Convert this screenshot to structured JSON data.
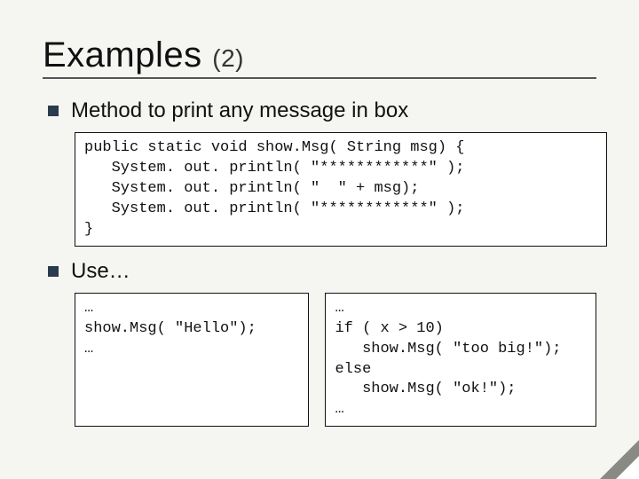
{
  "title": {
    "main": "Examples",
    "sub": "(2)"
  },
  "bullets": {
    "b1": "Method to print any message in box",
    "b2": "Use…"
  },
  "code": {
    "main": "public static void show.Msg( String msg) {\n   System. out. println( \"************\" );\n   System. out. println( \"  \" + msg);\n   System. out. println( \"************\" );\n}",
    "left": "…\nshow.Msg( \"Hello\");\n…",
    "right": "…\nif ( x > 10)\n   show.Msg( \"too big!\");\nelse\n   show.Msg( \"ok!\");\n…"
  }
}
